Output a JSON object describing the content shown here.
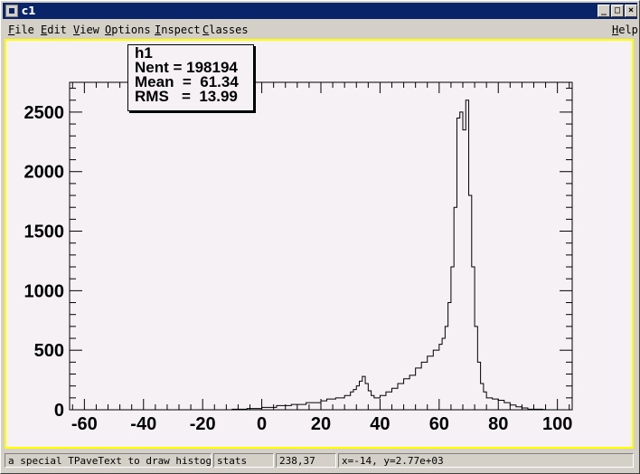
{
  "window": {
    "title": "c1",
    "min_glyph": "_",
    "max_glyph": "□",
    "close_glyph": "×"
  },
  "menubar": {
    "items": [
      "File",
      "Edit",
      "View",
      "Options",
      "Inspect",
      "Classes"
    ],
    "help": "Help"
  },
  "stats": {
    "name": "h1",
    "nent": "Nent = 198194",
    "mean": "Mean  =  61.34",
    "rms": "RMS   =  13.99"
  },
  "status": {
    "object_info": "a special TPaveText to draw histogram",
    "object_name": "stats",
    "pixel_coords": "238,37",
    "data_coords": "x=-14, y=2.77e+03"
  },
  "colors": {
    "canvas_bg": "#f5f1f5",
    "frame_border": "#ffff00",
    "title_bar": "#0a246a",
    "histogram_line": "#000000"
  },
  "chart_data": {
    "type": "histogram",
    "xlim": [
      -65,
      105
    ],
    "ylim": [
      0,
      2750
    ],
    "x_ticks": [
      -60,
      -40,
      -20,
      0,
      20,
      40,
      60,
      80,
      100
    ],
    "y_ticks": [
      0,
      500,
      1000,
      1500,
      2000,
      2500
    ],
    "bin_width": 1,
    "series": [
      {
        "x": [
          -10,
          -5,
          0,
          5,
          10,
          15,
          20,
          22,
          25,
          28,
          30,
          31,
          32,
          33,
          34,
          35,
          36,
          37,
          38,
          40,
          42,
          44,
          46,
          48,
          50,
          52,
          54,
          56,
          58,
          60,
          61,
          62,
          63,
          64,
          65,
          66,
          67,
          68,
          69,
          70,
          71,
          72,
          73,
          74,
          75,
          76,
          78,
          80,
          82,
          84,
          86,
          88,
          90,
          95
        ],
        "y": [
          5,
          10,
          20,
          35,
          45,
          60,
          75,
          90,
          100,
          120,
          150,
          170,
          200,
          240,
          280,
          220,
          160,
          120,
          100,
          120,
          150,
          180,
          220,
          260,
          290,
          350,
          400,
          450,
          500,
          550,
          600,
          700,
          900,
          1200,
          1700,
          2450,
          2500,
          2350,
          2600,
          1800,
          1200,
          700,
          400,
          220,
          150,
          100,
          90,
          80,
          60,
          40,
          25,
          15,
          5,
          2
        ]
      }
    ]
  }
}
